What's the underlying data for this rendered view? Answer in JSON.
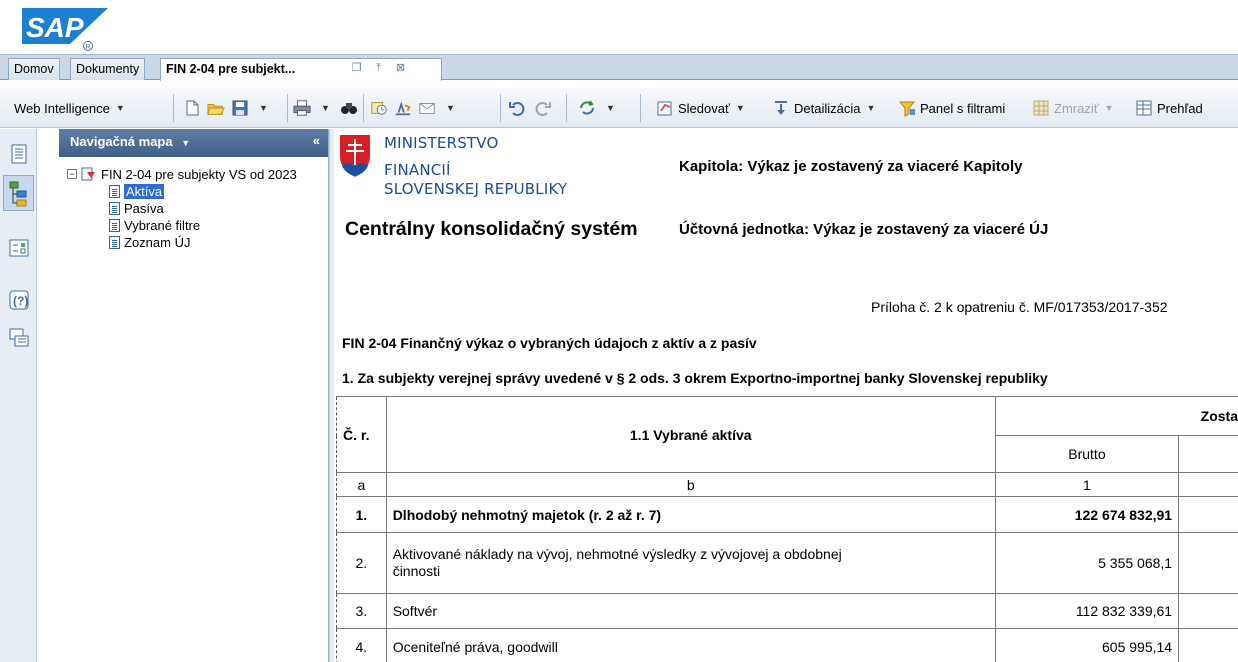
{
  "tabs": [
    {
      "label": "Domov"
    },
    {
      "label": "Dokumenty"
    },
    {
      "label": "FIN 2-04 pre subjekt..."
    }
  ],
  "toolbar": {
    "web_intelligence": "Web Intelligence",
    "track": "Sledovať",
    "drill": "Detailizácia",
    "filter_panel": "Panel s filtrami",
    "freeze": "Zmraziť",
    "outline": "Prehľad"
  },
  "nav": {
    "title": "Navigačná mapa",
    "root": "FIN 2-04 pre subjekty VS od 2023",
    "items": [
      "Aktíva",
      "Pasíva",
      "Vybrané filtre",
      "Zoznam ÚJ"
    ],
    "selected_index": 0
  },
  "report": {
    "ministry_lines": [
      "MINISTERSTVO",
      "FINANCIÍ",
      "SLOVENSKEJ REPUBLIKY"
    ],
    "chapter": "Kapitola: Výkaz je zostavený za viaceré Kapitoly",
    "system": "Centrálny konsolidačný systém",
    "unit": "Účtovná jednotka: Výkaz je zostavený za viaceré ÚJ",
    "annex": "Príloha č. 2 k opatreniu č. MF/017353/2017-352",
    "title": "FIN 2-04 Finančný výkaz o vybraných údajoch z aktív a z pasív",
    "subtitle": "1. Za subjekty  verejnej správy uvedené v § 2 ods. 3 okrem Exportno-importnej banky Slovenskej republiky",
    "table": {
      "col_num": "Č. r.",
      "col_name": "1.1 Vybrané aktíva",
      "col_group": "Zosta",
      "col_brutto": "Brutto",
      "letters": [
        "a",
        "b",
        "1"
      ],
      "rows": [
        {
          "num": "1.",
          "name": "Dlhodobý nehmotný majetok   (r. 2 až r. 7)",
          "brutto": "122 674 832,91",
          "bold": true
        },
        {
          "num": "2.",
          "name_lines": [
            "Aktivované náklady na vývoj, nehmotné výsledky z vývojovej a obdobnej",
            "činnosti"
          ],
          "brutto": "5 355 068,1",
          "bold": false
        },
        {
          "num": "3.",
          "name": "Softvér",
          "brutto": "112 832 339,61",
          "bold": false
        },
        {
          "num": "4.",
          "name": "Oceniteľné práva, goodwill",
          "brutto": "605 995,14",
          "bold": false
        }
      ]
    }
  }
}
